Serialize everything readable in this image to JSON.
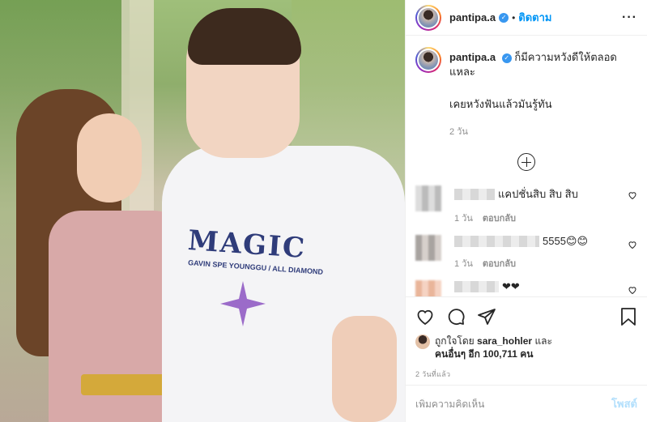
{
  "post": {
    "username": "pantipa.a",
    "follow_label": "ติดตาม",
    "separator": "•",
    "more_label": "···"
  },
  "photo": {
    "shirt_text": "MAGIC",
    "shirt_subtext": "GAVIN SPE YOUNGGU / ALL DIAMOND"
  },
  "caption": {
    "username": "pantipa.a",
    "text": "ก็มีความหวังดีให้ตลอดแหละ",
    "second_line": "เคยหวังฟันแล้วมันรู้ทัน",
    "time": "2 วัน"
  },
  "comments": [
    {
      "text": "แคปชั่นสิบ สิบ สิบ",
      "time": "1 วัน",
      "reply": "ตอบกลับ"
    },
    {
      "text": "5555😊😊",
      "time": "1 วัน",
      "reply": "ตอบกลับ"
    },
    {
      "text": "❤❤",
      "time": "",
      "reply": ""
    }
  ],
  "likes": {
    "prefix": "ถูกใจโดย",
    "user": "sara_hohler",
    "conj": "และ",
    "others": "คนอื่นๆ อีก 100,711 คน"
  },
  "posted_ago": "2 วันที่แล้ว",
  "add_comment": {
    "placeholder": "เพิ่มความคิดเห็น",
    "post_label": "โพสต์"
  },
  "colors": {
    "accent": "#0095f6",
    "post_disabled": "#b2dffc",
    "muted": "#8e8e8e"
  }
}
